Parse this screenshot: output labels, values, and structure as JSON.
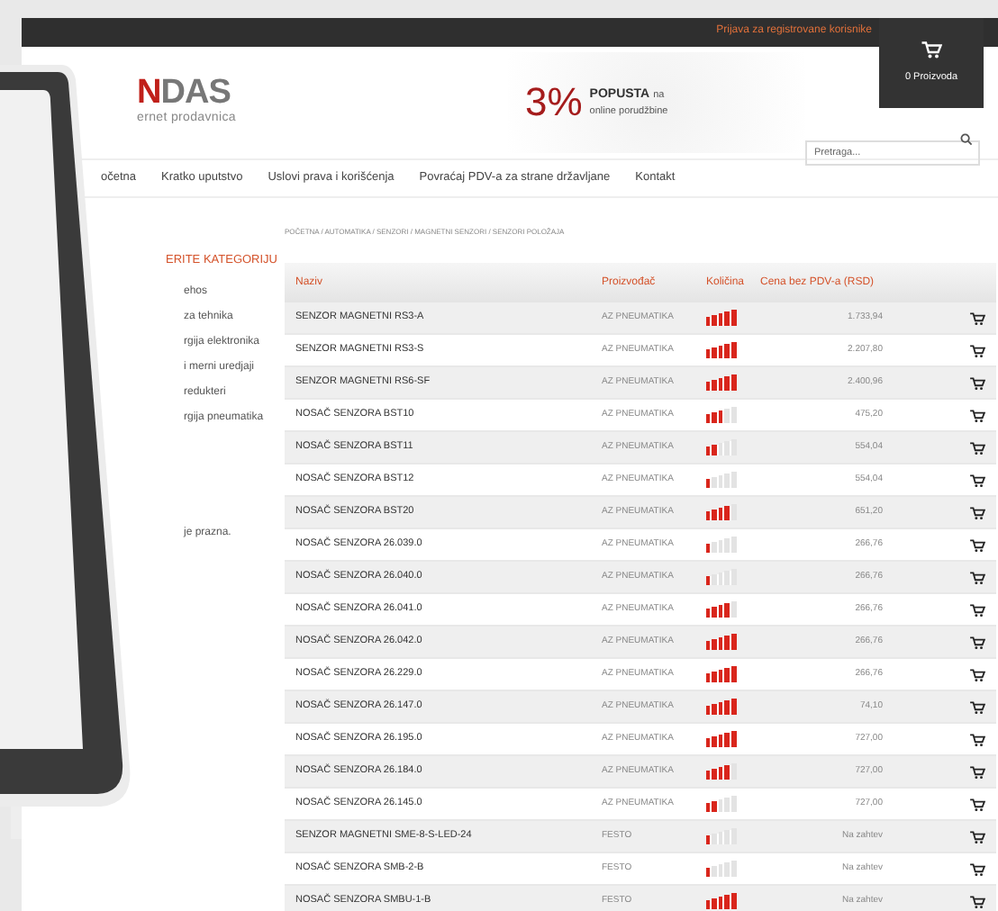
{
  "top_bar": {
    "login_link": "Prijava za registrovane korisnike",
    "cart": {
      "label": "0 Proizvoda"
    }
  },
  "logo": {
    "accent": "N",
    "rest": "DAS",
    "tagline": "ernet prodavnica"
  },
  "promo": {
    "percent": "3%",
    "headline": "POPUSTA",
    "headline_suffix": "na",
    "subline": "online porudžbine"
  },
  "search": {
    "placeholder": "Pretraga..."
  },
  "nav": [
    "očetna",
    "Kratko uputstvo",
    "Uslovi prava i korišćenja",
    "Povraćaj PDV-a za strane državljane",
    "Kontakt"
  ],
  "sidebar": {
    "title": "ERITE KATEGORIJU",
    "items": [
      "ehos",
      "za tehnika",
      "rgija elektronika",
      "i merni uredjaji",
      "redukteri",
      "rgija pneumatika"
    ],
    "cart_note": "je prazna."
  },
  "breadcrumb": "POČETNA / AUTOMATIKA / SENZORI / MAGNETNI SENZORI / SENZORI POLOŽAJA",
  "table": {
    "columns": [
      "Naziv",
      "Proizvođač",
      "Količina",
      "Cena bez PDV-a (RSD)"
    ],
    "rows": [
      {
        "name": "SENZOR MAGNETNI RS3-A",
        "maker": "AZ PNEUMATIKA",
        "level": 1,
        "price": "1.733,94"
      },
      {
        "name": "SENZOR MAGNETNI RS3-S",
        "maker": "AZ PNEUMATIKA",
        "level": 1,
        "price": "2.207,80"
      },
      {
        "name": "SENZOR MAGNETNI RS6-SF",
        "maker": "AZ PNEUMATIKA",
        "level": 1,
        "price": "2.400,96"
      },
      {
        "name": "NOSAČ SENZORA BST10",
        "maker": "AZ PNEUMATIKA",
        "level": 0.6,
        "price": "475,20"
      },
      {
        "name": "NOSAČ SENZORA BST11",
        "maker": "AZ PNEUMATIKA",
        "level": 0.4,
        "price": "554,04"
      },
      {
        "name": "NOSAČ SENZORA BST12",
        "maker": "AZ PNEUMATIKA",
        "level": 0.2,
        "price": "554,04"
      },
      {
        "name": "NOSAČ SENZORA BST20",
        "maker": "AZ PNEUMATIKA",
        "level": 0.8,
        "price": "651,20"
      },
      {
        "name": "NOSAČ SENZORA 26.039.0",
        "maker": "AZ PNEUMATIKA",
        "level": 0.2,
        "price": "266,76"
      },
      {
        "name": "NOSAČ SENZORA 26.040.0",
        "maker": "AZ PNEUMATIKA",
        "level": 0.2,
        "price": "266,76"
      },
      {
        "name": "NOSAČ SENZORA 26.041.0",
        "maker": "AZ PNEUMATIKA",
        "level": 0.8,
        "price": "266,76"
      },
      {
        "name": "NOSAČ SENZORA 26.042.0",
        "maker": "AZ PNEUMATIKA",
        "level": 1,
        "price": "266,76"
      },
      {
        "name": "NOSAČ SENZORA 26.229.0",
        "maker": "AZ PNEUMATIKA",
        "level": 1,
        "price": "266,76"
      },
      {
        "name": "NOSAČ SENZORA 26.147.0",
        "maker": "AZ PNEUMATIKA",
        "level": 1,
        "price": "74,10"
      },
      {
        "name": "NOSAČ SENZORA 26.195.0",
        "maker": "AZ PNEUMATIKA",
        "level": 1,
        "price": "727,00"
      },
      {
        "name": "NOSAČ SENZORA 26.184.0",
        "maker": "AZ PNEUMATIKA",
        "level": 0.8,
        "price": "727,00"
      },
      {
        "name": "NOSAČ SENZORA 26.145.0",
        "maker": "AZ PNEUMATIKA",
        "level": 0.4,
        "price": "727,00"
      },
      {
        "name": "SENZOR MAGNETNI SME-8-S-LED-24",
        "maker": "FESTO",
        "level": 0.2,
        "price": "Na zahtev"
      },
      {
        "name": "NOSAČ SENZORA SMB-2-B",
        "maker": "FESTO",
        "level": 0.2,
        "price": "Na zahtev"
      },
      {
        "name": "NOSAČ SENZORA SMBU-1-B",
        "maker": "FESTO",
        "level": 1,
        "price": "Na zahtev"
      }
    ]
  }
}
